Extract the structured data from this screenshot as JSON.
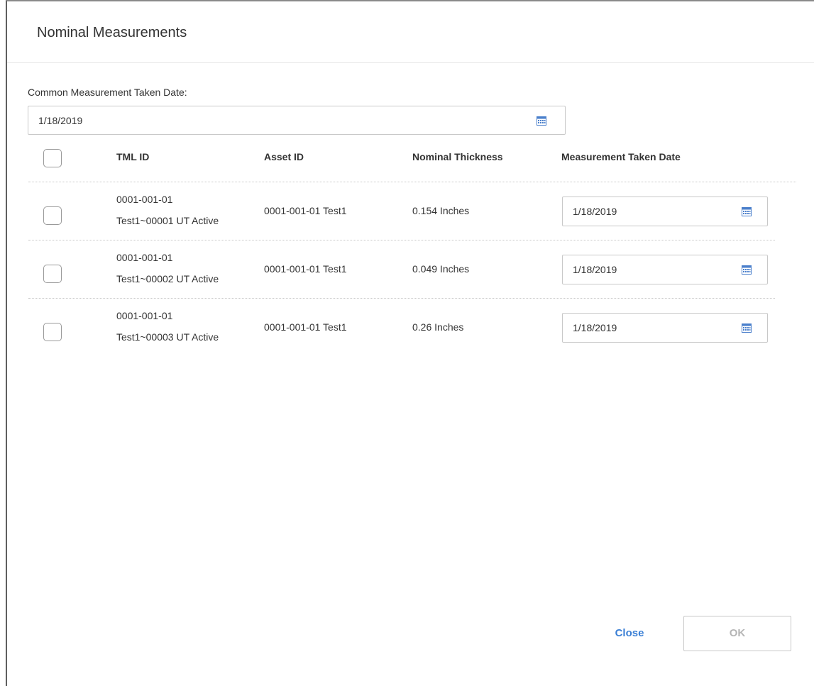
{
  "dialog": {
    "title": "Nominal Measurements",
    "common_date_label": "Common Measurement Taken Date:",
    "common_date_value": "1/18/2019"
  },
  "table": {
    "headers": {
      "tml_id": "TML ID",
      "asset_id": "Asset ID",
      "nominal_thickness": "Nominal Thickness",
      "measurement_date": "Measurement Taken Date"
    },
    "rows": [
      {
        "tml_id_line1": "0001-001-01",
        "tml_id_line2": "Test1~00001 UT Active",
        "asset_id": "0001-001-01 Test1",
        "nominal_thickness": "0.154 Inches",
        "measurement_date": "1/18/2019"
      },
      {
        "tml_id_line1": "0001-001-01",
        "tml_id_line2": "Test1~00002 UT Active",
        "asset_id": "0001-001-01 Test1",
        "nominal_thickness": "0.049 Inches",
        "measurement_date": "1/18/2019"
      },
      {
        "tml_id_line1": "0001-001-01",
        "tml_id_line2": "Test1~00003 UT Active",
        "asset_id": "0001-001-01 Test1",
        "nominal_thickness": "0.26 Inches",
        "measurement_date": "1/18/2019"
      }
    ]
  },
  "footer": {
    "close_label": "Close",
    "ok_label": "OK"
  },
  "colors": {
    "link_blue": "#3a7fd5",
    "calendar_icon": "#4a7fcb",
    "disabled_text": "#b5b5b5"
  },
  "icons": {
    "calendar": "calendar-icon"
  }
}
